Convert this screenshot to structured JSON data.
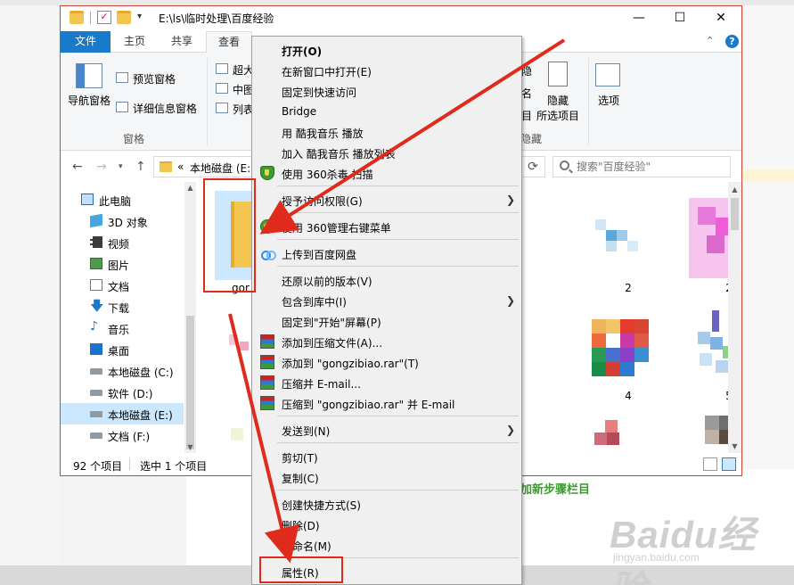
{
  "window": {
    "title": "E:\\ls\\临时处理\\百度经验",
    "minimize_glyph": "—",
    "maximize_glyph": "☐",
    "close_glyph": "✕"
  },
  "ribbon": {
    "tabs": [
      {
        "label": "文件"
      },
      {
        "label": "主页"
      },
      {
        "label": "共享"
      },
      {
        "label": "查看"
      }
    ],
    "nav_pane_label": "导航窗格",
    "preview_pane_label": "预览窗格",
    "details_pane_label": "详细信息窗格",
    "panes_group_label": "窗格",
    "layout_items": [
      "超大",
      "中图",
      "列表"
    ],
    "show_hide_partial_top": "隐",
    "show_hide_partial_mid": "名",
    "show_hide_partial_bottom": "目",
    "show_hide_partial_group": "隐藏",
    "hide_selected_label_line1": "隐藏",
    "hide_selected_label_line2": "所选项目",
    "options_label": "选项",
    "collapse_glyph": "⌃",
    "help_glyph": "?"
  },
  "address": {
    "path_prefix": "«",
    "path_text": "本地磁盘 (E:",
    "refresh_glyph": "⟳",
    "search_placeholder": "搜索\"百度经验\""
  },
  "nav_pane": {
    "items": [
      {
        "label": "此电脑"
      },
      {
        "label": "3D 对象"
      },
      {
        "label": "视频"
      },
      {
        "label": "图片"
      },
      {
        "label": "文档"
      },
      {
        "label": "下载"
      },
      {
        "label": "音乐"
      },
      {
        "label": "桌面"
      },
      {
        "label": "本地磁盘 (C:)"
      },
      {
        "label": "软件 (D:)"
      },
      {
        "label": "本地磁盘 (E:)"
      },
      {
        "label": "文档 (F:)"
      }
    ],
    "download_glyph": "🡇",
    "music_glyph": "♪"
  },
  "files": {
    "selected_folder_label": "gor",
    "thumb_labels": [
      "2",
      "2",
      "4",
      "5"
    ]
  },
  "status": {
    "item_count": "92 个项目",
    "selected_count": "选中 1 个项目"
  },
  "context_menu": {
    "items": [
      {
        "label": "打开(O)"
      },
      {
        "label": "在新窗口中打开(E)"
      },
      {
        "label": "固定到快速访问"
      },
      {
        "label": "Bridge"
      },
      {
        "label": "用 酷我音乐 播放"
      },
      {
        "label": "加入 酷我音乐 播放列表"
      },
      {
        "label": "使用 360杀毒 扫描"
      },
      {
        "label": "授予访问权限(G)"
      },
      {
        "label": "使用 360管理右键菜单"
      },
      {
        "label": "上传到百度网盘"
      },
      {
        "label": "还原以前的版本(V)"
      },
      {
        "label": "包含到库中(I)"
      },
      {
        "label": "固定到\"开始\"屏幕(P)"
      },
      {
        "label": "添加到压缩文件(A)..."
      },
      {
        "label": "添加到 \"gongzibiao.rar\"(T)"
      },
      {
        "label": "压缩并 E-mail..."
      },
      {
        "label": "压缩到 \"gongzibiao.rar\" 并 E-mail"
      },
      {
        "label": "发送到(N)"
      },
      {
        "label": "剪切(T)"
      },
      {
        "label": "复制(C)"
      },
      {
        "label": "创建快捷方式(S)"
      },
      {
        "label": "删除(D)"
      },
      {
        "label": "重命名(M)"
      },
      {
        "label": "属性(R)"
      }
    ],
    "submenu_arrow": "❯"
  },
  "background_page": {
    "link_text": "加新步骤栏目",
    "watermark_logo": "Baidu经验",
    "watermark_sub": "jingyan.baidu.com"
  },
  "annotation_color": "#e02a1c"
}
